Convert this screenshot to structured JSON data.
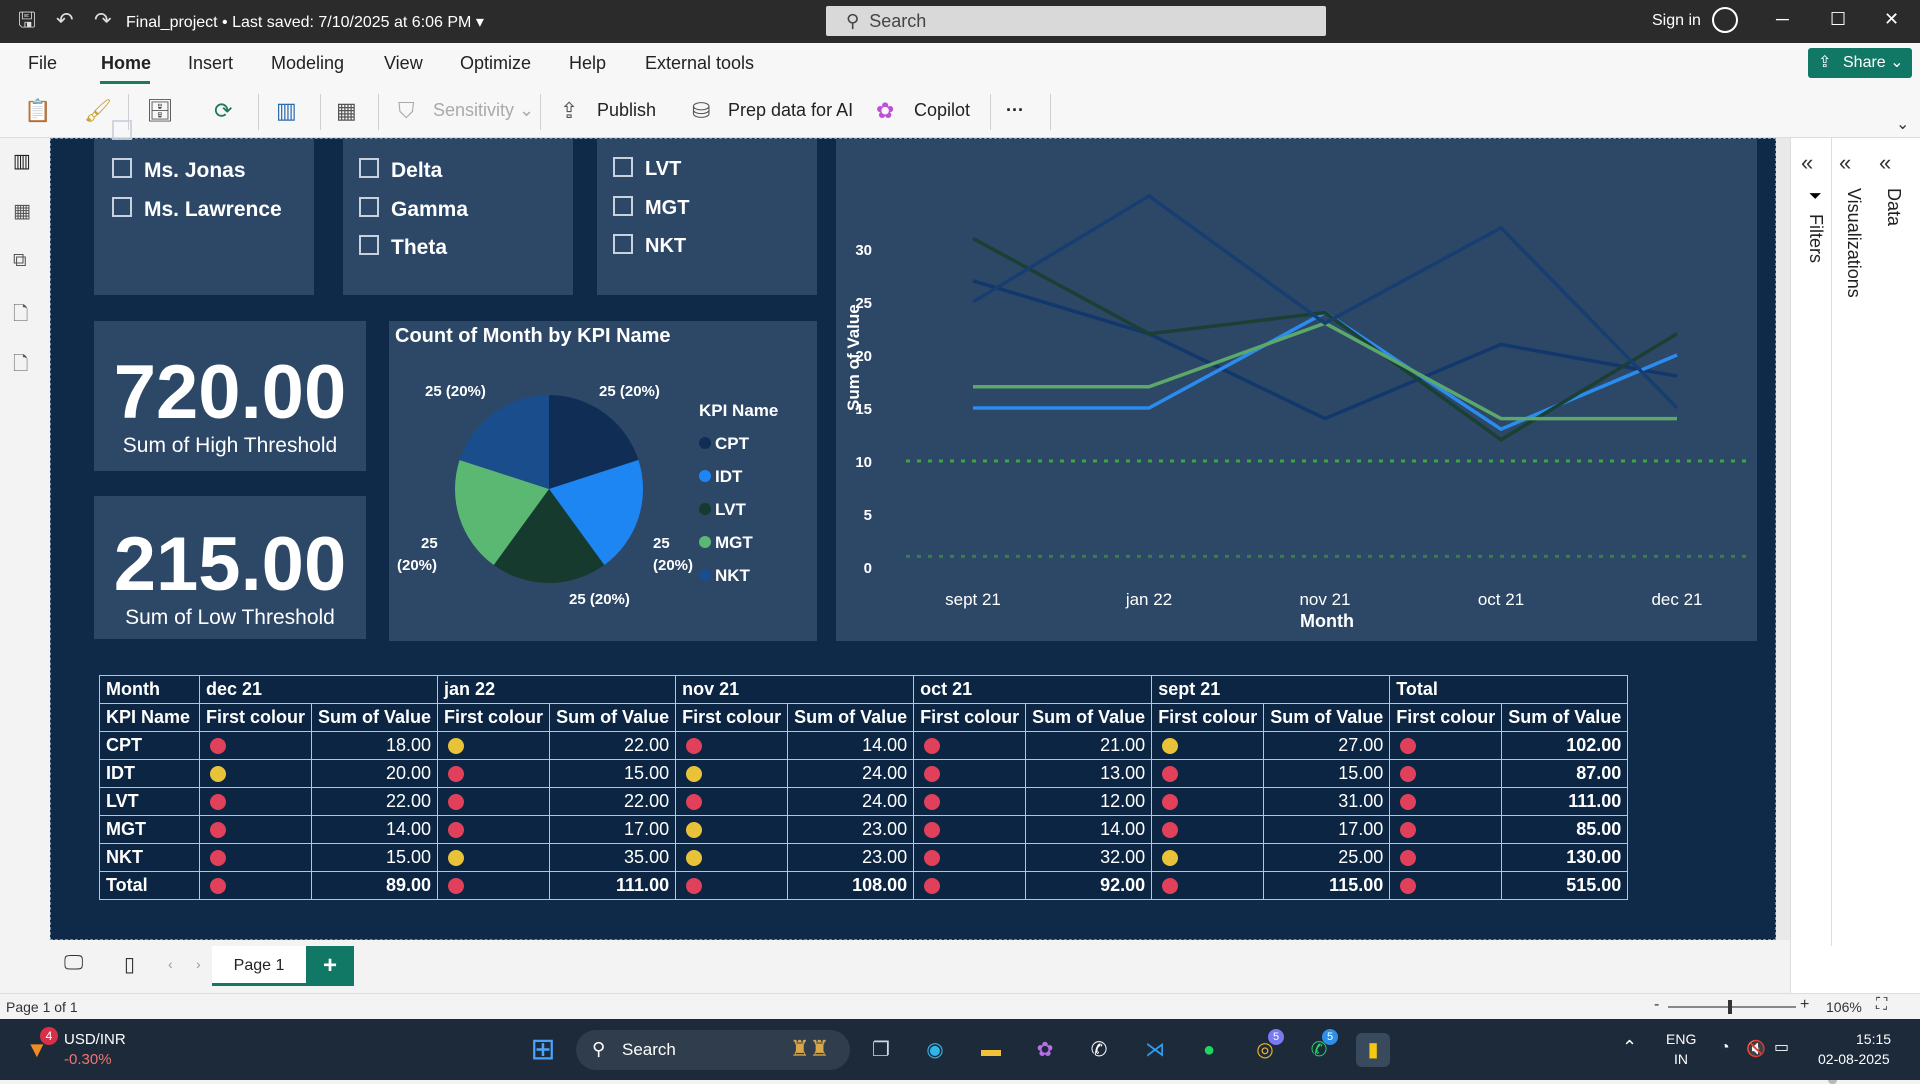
{
  "titlebar": {
    "file_title": "Final_project",
    "saved_status": "Last saved: 7/10/2025 at 6:06 PM",
    "search_placeholder": "Search",
    "sign_in": "Sign in"
  },
  "menu": {
    "items": [
      "File",
      "Home",
      "Insert",
      "Modeling",
      "View",
      "Optimize",
      "Help",
      "External tools"
    ],
    "active": "Home",
    "share_label": "Share"
  },
  "ribbon": {
    "sensitivity": "Sensitivity",
    "publish": "Publish",
    "prep_data": "Prep data for AI",
    "copilot": "Copilot",
    "more": "···"
  },
  "slicers": {
    "col1": [
      "Ms. Jonas",
      "Ms. Lawrence"
    ],
    "col2": [
      "Delta",
      "Gamma",
      "Theta"
    ],
    "col3": [
      "LVT",
      "MGT",
      "NKT"
    ]
  },
  "cards": [
    {
      "value": "720.00",
      "label": "Sum of High Threshold"
    },
    {
      "value": "215.00",
      "label": "Sum of Low Threshold"
    }
  ],
  "pie": {
    "title": "Count of Month by KPI Name",
    "legend_title": "KPI Name",
    "labels": {
      "top_left": "25 (20%)",
      "top_right": "25 (20%)",
      "left_value": "25",
      "left_pct": "(20%)",
      "right_value": "25",
      "right_pct": "(20%)",
      "bottom": "25 (20%)"
    }
  },
  "line_chart": {
    "y_axis_label": "Sum of Value",
    "x_axis_label": "Month",
    "y_ticks": [
      "0",
      "5",
      "10",
      "15",
      "20",
      "25",
      "30"
    ],
    "x_ticks": [
      "sept 21",
      "jan 22",
      "nov 21",
      "oct 21",
      "dec 21"
    ]
  },
  "chart_data": [
    {
      "type": "pie",
      "title": "Count of Month by KPI Name",
      "categories": [
        "CPT",
        "IDT",
        "LVT",
        "MGT",
        "NKT"
      ],
      "values": [
        25,
        25,
        25,
        25,
        25
      ],
      "colors": [
        "#0f2d55",
        "#1e86f3",
        "#163a2e",
        "#5bb873",
        "#1a4d8c"
      ],
      "legend": "right"
    },
    {
      "type": "line",
      "title": "",
      "xlabel": "Month",
      "ylabel": "Sum of Value",
      "categories": [
        "sept 21",
        "jan 22",
        "nov 21",
        "oct 21",
        "dec 21"
      ],
      "ylim": [
        0,
        32
      ],
      "series": [
        {
          "name": "CPT",
          "values": [
            27,
            22,
            14,
            21,
            18
          ],
          "color": "#12386b"
        },
        {
          "name": "IDT",
          "values": [
            15,
            15,
            24,
            13,
            20
          ],
          "color": "#2b8cf0"
        },
        {
          "name": "LVT",
          "values": [
            31,
            22,
            24,
            12,
            22
          ],
          "color": "#1a3f33"
        },
        {
          "name": "MGT",
          "values": [
            17,
            17,
            23,
            14,
            14
          ],
          "color": "#5ca86a"
        },
        {
          "name": "NKT",
          "values": [
            25,
            35,
            23,
            32,
            15
          ],
          "color": "#173e70"
        }
      ],
      "reference_lines": [
        {
          "value": 10,
          "style": "dotted",
          "color": "#3aa541"
        },
        {
          "value": 1,
          "style": "dotted",
          "color": "#3a7f45"
        }
      ],
      "grid": false
    }
  ],
  "matrix": {
    "header1": [
      "Month",
      "dec 21",
      "jan 22",
      "nov 21",
      "oct 21",
      "sept 21",
      "Total"
    ],
    "header2": [
      "KPI Name",
      "First colour",
      "Sum of Value",
      "First colour",
      "Sum of Value",
      "First colour",
      "Sum of Value",
      "First colour",
      "Sum of Value",
      "First colour",
      "Sum of Value",
      "First colour",
      "Sum of Value"
    ],
    "rows": [
      {
        "name": "CPT",
        "cells": [
          [
            "red",
            "18.00"
          ],
          [
            "yellow",
            "22.00"
          ],
          [
            "red",
            "14.00"
          ],
          [
            "red",
            "21.00"
          ],
          [
            "yellow",
            "27.00"
          ],
          [
            "red",
            "102.00"
          ]
        ]
      },
      {
        "name": "IDT",
        "cells": [
          [
            "yellow",
            "20.00"
          ],
          [
            "red",
            "15.00"
          ],
          [
            "yellow",
            "24.00"
          ],
          [
            "red",
            "13.00"
          ],
          [
            "red",
            "15.00"
          ],
          [
            "red",
            "87.00"
          ]
        ]
      },
      {
        "name": "LVT",
        "cells": [
          [
            "red",
            "22.00"
          ],
          [
            "red",
            "22.00"
          ],
          [
            "red",
            "24.00"
          ],
          [
            "red",
            "12.00"
          ],
          [
            "red",
            "31.00"
          ],
          [
            "red",
            "111.00"
          ]
        ]
      },
      {
        "name": "MGT",
        "cells": [
          [
            "red",
            "14.00"
          ],
          [
            "red",
            "17.00"
          ],
          [
            "yellow",
            "23.00"
          ],
          [
            "red",
            "14.00"
          ],
          [
            "red",
            "17.00"
          ],
          [
            "red",
            "85.00"
          ]
        ]
      },
      {
        "name": "NKT",
        "cells": [
          [
            "red",
            "15.00"
          ],
          [
            "yellow",
            "35.00"
          ],
          [
            "yellow",
            "23.00"
          ],
          [
            "red",
            "32.00"
          ],
          [
            "yellow",
            "25.00"
          ],
          [
            "red",
            "130.00"
          ]
        ]
      },
      {
        "name": "Total",
        "cells": [
          [
            "red",
            "89.00"
          ],
          [
            "red",
            "111.00"
          ],
          [
            "red",
            "108.00"
          ],
          [
            "red",
            "92.00"
          ],
          [
            "red",
            "115.00"
          ],
          [
            "red",
            "515.00"
          ]
        ]
      }
    ],
    "dot_colors": {
      "red": "#e0405a",
      "yellow": "#e8c33a"
    }
  },
  "pane_labels": {
    "filters": "Filters",
    "visualizations": "Visualizations",
    "data": "Data"
  },
  "page_tab": "Page 1",
  "status": {
    "page_info": "Page 1 of 1",
    "zoom": "106%"
  },
  "taskbar": {
    "stock_name": "USD/INR",
    "stock_change": "-0.30%",
    "stock_badge": "4",
    "search": "Search",
    "lang_1": "ENG",
    "lang_2": "IN",
    "time": "15:15",
    "date": "02-08-2025",
    "badge_chrome": "5",
    "badge_whatsapp": "5"
  }
}
